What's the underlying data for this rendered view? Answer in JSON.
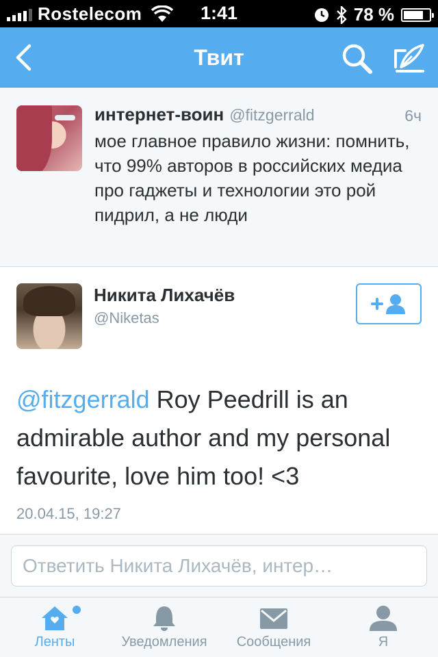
{
  "status_bar": {
    "carrier": "Rostelecom",
    "time": "1:41",
    "battery_percent": "78 %",
    "battery_level": 0.78
  },
  "nav": {
    "title": "Твит",
    "icons": {
      "back": "chevron-left-icon",
      "search": "search-icon",
      "compose": "compose-icon"
    }
  },
  "parent_tweet": {
    "name": "интернет-воин",
    "handle": "@fitzgerrald",
    "time": "6ч",
    "text": "мое главное правило жизни: помнить, что 99% авторов в российских медиа про гаджеты и технологии это рой пидрил, а не люди"
  },
  "tweet": {
    "name": "Никита Лихачёв",
    "handle": "@Niketas",
    "mention": "@fitzgerrald",
    "text": " Roy Peedrill is an admirable author and my personal favourite, love him too! <3",
    "date": "20.04.15, 19:27"
  },
  "reply": {
    "placeholder": "Ответить Никита Лихачёв, интер…"
  },
  "tabs": [
    {
      "label": "Ленты",
      "icon": "home-icon",
      "active": true
    },
    {
      "label": "Уведомления",
      "icon": "bell-icon",
      "active": false
    },
    {
      "label": "Сообщения",
      "icon": "envelope-icon",
      "active": false
    },
    {
      "label": "Я",
      "icon": "person-icon",
      "active": false
    }
  ],
  "colors": {
    "accent": "#55acee",
    "text": "#292f33",
    "muted": "#8899a6",
    "background_alt": "#f5f8fa"
  }
}
